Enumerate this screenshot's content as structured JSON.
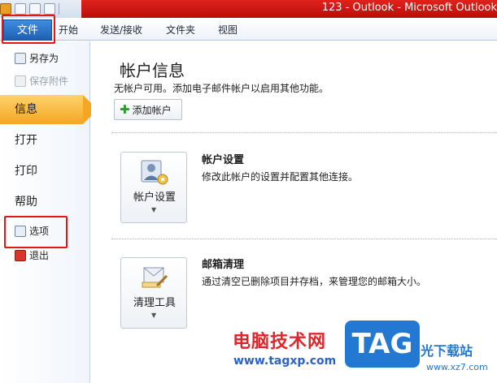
{
  "window": {
    "title": "123 - Outlook - Microsoft Outlook"
  },
  "ribbon": {
    "tabs": [
      {
        "label": "文件"
      },
      {
        "label": "开始"
      },
      {
        "label": "发送/接收"
      },
      {
        "label": "文件夹"
      },
      {
        "label": "视图"
      }
    ]
  },
  "nav": {
    "save_as": "另存为",
    "save_attachments": "保存附件",
    "info": "信息",
    "open": "打开",
    "print": "打印",
    "help": "帮助",
    "options": "选项",
    "exit": "退出"
  },
  "main": {
    "title": "帐户信息",
    "subtitle": "无帐户可用。添加电子邮件帐户以启用其他功能。",
    "add_account": "添加帐户",
    "account_settings": {
      "button_label": "帐户设置",
      "title": "帐户设置",
      "description": "修改此帐户的设置并配置其他连接。"
    },
    "mailbox_cleanup": {
      "button_label": "清理工具",
      "title": "邮箱清理",
      "description": "通过清空已删除项目并存档，来管理您的邮箱大小。"
    }
  },
  "watermark": {
    "brand": "电脑技术网",
    "url": "www.tagxp.com",
    "logo": "TAG",
    "site": "光下载站",
    "site_url": "www.xz7.com"
  },
  "colors": {
    "accent_red": "#e21818",
    "active_nav": "#f5a623",
    "file_tab": "#1d5fb4"
  }
}
